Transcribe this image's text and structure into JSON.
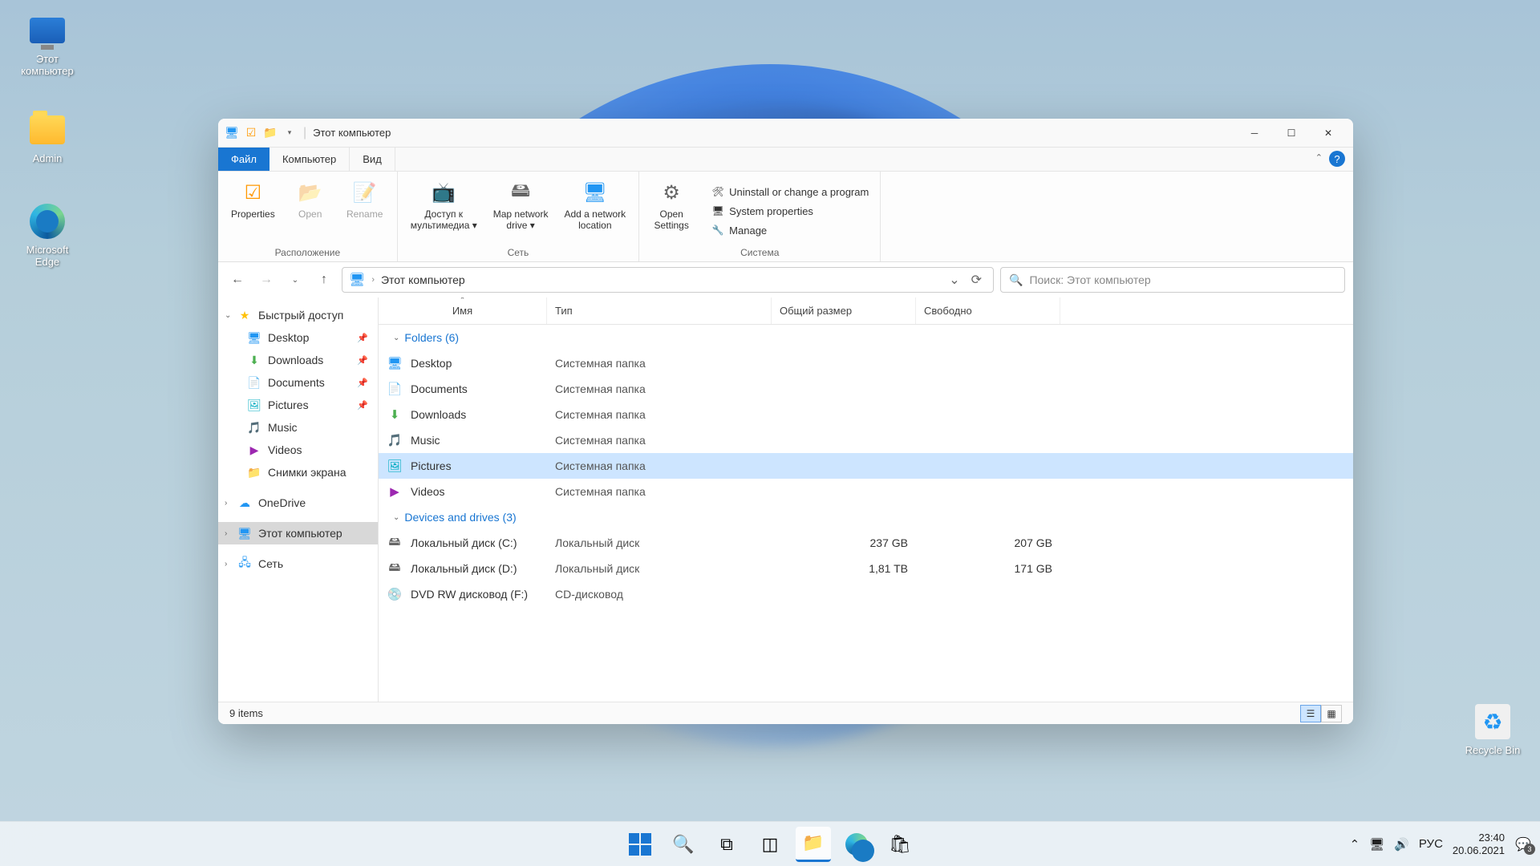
{
  "desktop": {
    "this_pc": "Этот\nкомпьютер",
    "admin": "Admin",
    "edge": "Microsoft\nEdge",
    "recycle": "Recycle Bin"
  },
  "titlebar": {
    "title": "Этот компьютер"
  },
  "tabs": {
    "file": "Файл",
    "computer": "Компьютер",
    "view": "Вид"
  },
  "ribbon": {
    "properties": "Properties",
    "open": "Open",
    "rename": "Rename",
    "group_location": "Расположение",
    "media": "Доступ к\nмультимедиа ▾",
    "mapdrive": "Map network\ndrive ▾",
    "addloc": "Add a network\nlocation",
    "group_network": "Сеть",
    "settings": "Open\nSettings",
    "uninstall": "Uninstall or change a program",
    "sysprops": "System properties",
    "manage": "Manage",
    "group_system": "Система"
  },
  "nav": {
    "address": "Этот компьютер",
    "search_placeholder": "Поиск: Этот компьютер"
  },
  "sidebar": {
    "quick": "Быстрый доступ",
    "desktop": "Desktop",
    "downloads": "Downloads",
    "documents": "Documents",
    "pictures": "Pictures",
    "music": "Music",
    "videos": "Videos",
    "screenshots": "Снимки экрана",
    "onedrive": "OneDrive",
    "thispc": "Этот компьютер",
    "network": "Сеть"
  },
  "columns": {
    "name": "Имя",
    "type": "Тип",
    "size": "Общий размер",
    "free": "Свободно"
  },
  "groups": {
    "folders": "Folders (6)",
    "drives": "Devices and drives (3)"
  },
  "folders": [
    {
      "name": "Desktop",
      "type": "Системная папка",
      "icon": "🖥",
      "cls": "c-blue"
    },
    {
      "name": "Documents",
      "type": "Системная папка",
      "icon": "📄",
      "cls": "c-gray"
    },
    {
      "name": "Downloads",
      "type": "Системная папка",
      "icon": "⬇",
      "cls": "c-green"
    },
    {
      "name": "Music",
      "type": "Системная папка",
      "icon": "🎵",
      "cls": "c-orange"
    },
    {
      "name": "Pictures",
      "type": "Системная папка",
      "icon": "🖼",
      "cls": "c-teal",
      "selected": true
    },
    {
      "name": "Videos",
      "type": "Системная папка",
      "icon": "▶",
      "cls": "c-purple"
    }
  ],
  "drives": [
    {
      "name": "Локальный диск (C:)",
      "type": "Локальный диск",
      "size": "237 GB",
      "free": "207 GB",
      "icon": "🖴"
    },
    {
      "name": "Локальный диск (D:)",
      "type": "Локальный диск",
      "size": "1,81 TB",
      "free": "171 GB",
      "icon": "🖴"
    },
    {
      "name": "DVD RW дисковод (F:)",
      "type": "CD-дисковод",
      "size": "",
      "free": "",
      "icon": "💿"
    }
  ],
  "status": {
    "count": "9 items"
  },
  "taskbar": {
    "lang": "РУС",
    "time": "23:40",
    "date": "20.06.2021",
    "notif_count": "3"
  }
}
